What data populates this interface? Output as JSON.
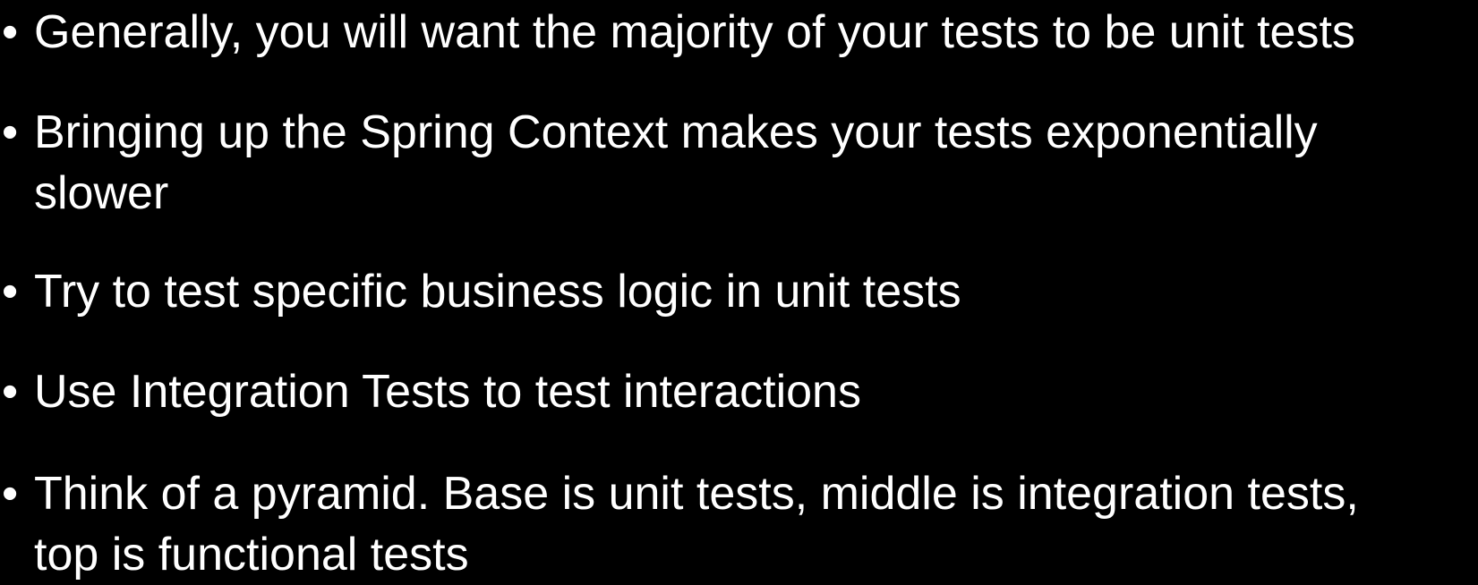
{
  "slide": {
    "bullet_symbol": "•",
    "bullets": [
      {
        "text": "Generally, you will want the majority of your tests to be unit tests"
      },
      {
        "text": "Bringing up the Spring Context makes your tests exponentially slower"
      },
      {
        "text": "Try to test specific business logic in unit tests"
      },
      {
        "text": "Use Integration Tests to test interactions"
      },
      {
        "text": "Think of a pyramid. Base is unit tests, middle is integration tests, top is functional tests"
      }
    ]
  },
  "colors": {
    "background": "#000000",
    "text": "#ffffff"
  }
}
